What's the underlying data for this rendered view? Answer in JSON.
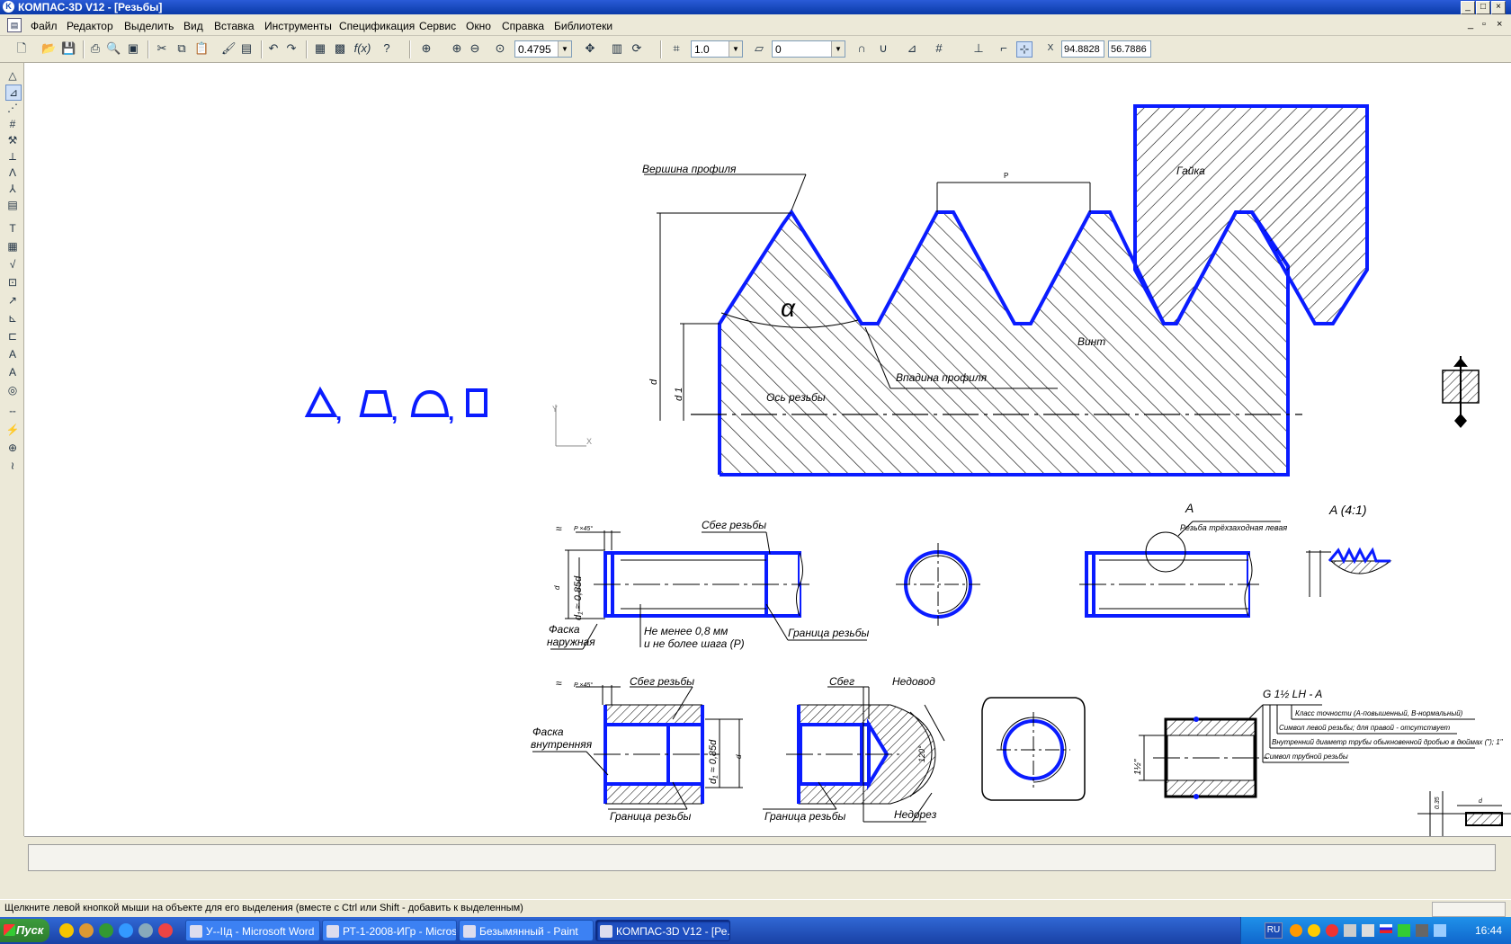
{
  "window": {
    "title": "КОМПАС-3D V12 - [Резьбы]",
    "buttons": [
      "_",
      "□",
      "×"
    ],
    "mdi_buttons": [
      "_",
      "▫",
      "×"
    ]
  },
  "menu": [
    "Файл",
    "Редактор",
    "Выделить",
    "Вид",
    "Вставка",
    "Инструменты",
    "Спецификация",
    "Сервис",
    "Окно",
    "Справка",
    "Библиотеки"
  ],
  "toolbar": {
    "zoom": "0.4795",
    "step": "1.0",
    "layer": "0",
    "coord_x": "94.8828",
    "coord_y": "56.7886",
    "coord_label": "X"
  },
  "drawing": {
    "profile_top": "Вершина профиля",
    "pitch": "P",
    "nut": "Гайка",
    "alpha": "α",
    "screw": "Винт",
    "d": "d",
    "d1": "d 1",
    "valley": "Впадина профиля",
    "axis": "Ось резьбы",
    "axis_y": "Y",
    "axis_x": "X",
    "shapes_sep": ",",
    "approx": "≈",
    "chamfer_dim": "P ×45°",
    "thread_runout": "Сбег резьбы",
    "d1_085": "d₁ ≈ 0,85d",
    "ext_chamfer_1": "Фаска",
    "ext_chamfer_2": "наружная",
    "min_len_1": "Не менее 0,8 мм",
    "min_len_2": "и не более шага (P)",
    "thread_border": "Граница резьбы",
    "view_a": "A",
    "view_a_scale": "A (4:1)",
    "three_start": "Резьба трёхзаходная левая",
    "int_chamfer_1": "Фаска",
    "int_chamfer_2": "внутренняя",
    "runout": "Сбег",
    "undercut_drill": "Недовод",
    "undercut": "Недорез",
    "angle_120": "120°",
    "pipe_mark": "G 1½ LH - A",
    "legend_1": "Класс точности (A-повышенный, B-нормальный)",
    "legend_2": "Символ левой резьбы; для правой - отсутствует",
    "legend_3": "Внутренний диаметр трубы обыкновенной дробью в дюймах (\"); 1\"",
    "legend_4": "Символ трубной резьбы",
    "pipe_size": "1½\"",
    "corner_1": "0.35",
    "corner_2": "d"
  },
  "status": "Щелкните левой кнопкой мыши на объекте для его выделения (вместе с Ctrl или Shift - добавить к выделенным)",
  "taskbar": {
    "start": "Пуск",
    "tasks": [
      "У--ІІд - Microsoft Word",
      "РТ-1-2008-ИГр - Microso...",
      "Безымянный - Paint",
      "КОМПАС-3D V12 - [Ре..."
    ],
    "lang": "RU",
    "clock": "16:44"
  },
  "colors": {
    "accent_blue": "#0a1cff",
    "hatch": "#000000"
  }
}
